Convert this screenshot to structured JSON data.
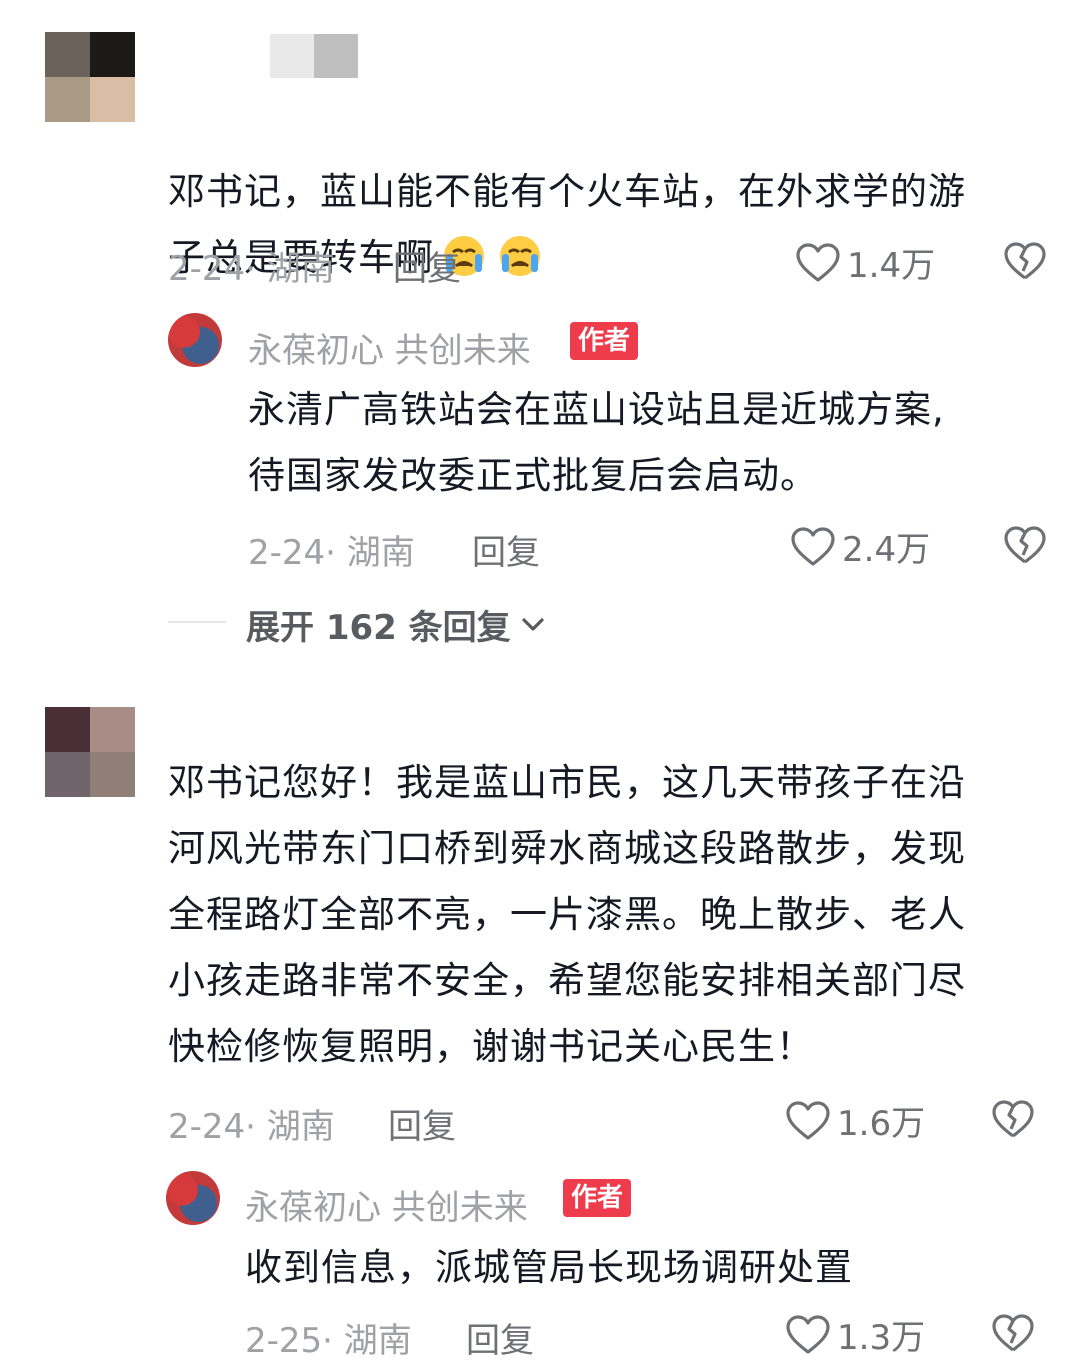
{
  "comments": [
    {
      "text": "邓书记，蓝山能不能有个火车站，在外求学的游\n子总是要转车啊",
      "emoji": [
        "crying-face",
        "crying-face"
      ],
      "meta": "2-24· 湖南",
      "reply_label": "回复",
      "likes": "1.4万",
      "author_reply": {
        "name": "永葆初心  共创未来",
        "badge": "作者",
        "text": "永清广高铁站会在蓝山设站且是近城方案,\n待国家发改委正式批复后会启动。",
        "meta": "2-24· 湖南",
        "reply_label": "回复",
        "likes": "2.4万"
      },
      "expand_label": "展开 162 条回复"
    },
    {
      "text": "邓书记您好！我是蓝山市民，这几天带孩子在沿\n河风光带东门口桥到舜水商城这段路散步，发现\n全程路灯全部不亮，一片漆黑。晚上散步、老人\n小孩走路非常不安全，希望您能安排相关部门尽\n快检修恢复照明，谢谢书记关心民生！",
      "meta": "2-24· 湖南",
      "reply_label": "回复",
      "likes": "1.6万",
      "author_reply": {
        "name": "永葆初心  共创未来",
        "badge": "作者",
        "text": "收到信息，派城管局长现场调研处置",
        "meta": "2-25· 湖南",
        "reply_label": "回复",
        "likes": "1.3万"
      }
    }
  ],
  "colors": {
    "badge": "#ee3c4d",
    "text": "#161823",
    "meta": "#a0a1a6"
  }
}
